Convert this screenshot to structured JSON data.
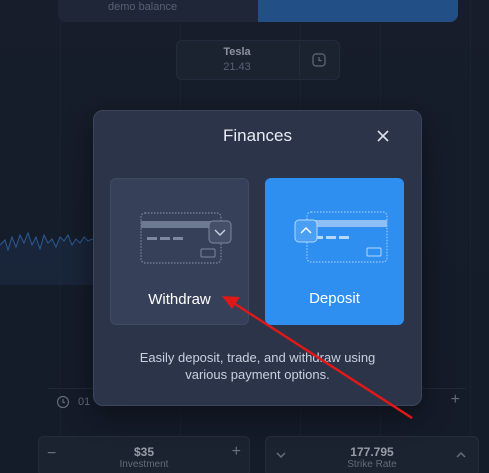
{
  "background": {
    "balance_caption": "demo balance",
    "asset": {
      "name": "Tesla",
      "price": "21.43"
    },
    "time_value": "01",
    "investment": {
      "value": "$35",
      "label": "Investment",
      "minus": "−",
      "plus": "+"
    },
    "strike": {
      "value": "177.795",
      "label": "Strike Rate"
    },
    "time_plus": "+"
  },
  "modal": {
    "title": "Finances",
    "options": [
      {
        "label": "Withdraw",
        "icon": "card-withdraw-icon"
      },
      {
        "label": "Deposit",
        "icon": "card-deposit-icon"
      }
    ],
    "description": "Easily deposit, trade, and withdraw using various payment options."
  },
  "colors": {
    "deposit_accent": "#2e8ff0",
    "modal_bg": "#2b3449",
    "annotation": "#e01818"
  }
}
